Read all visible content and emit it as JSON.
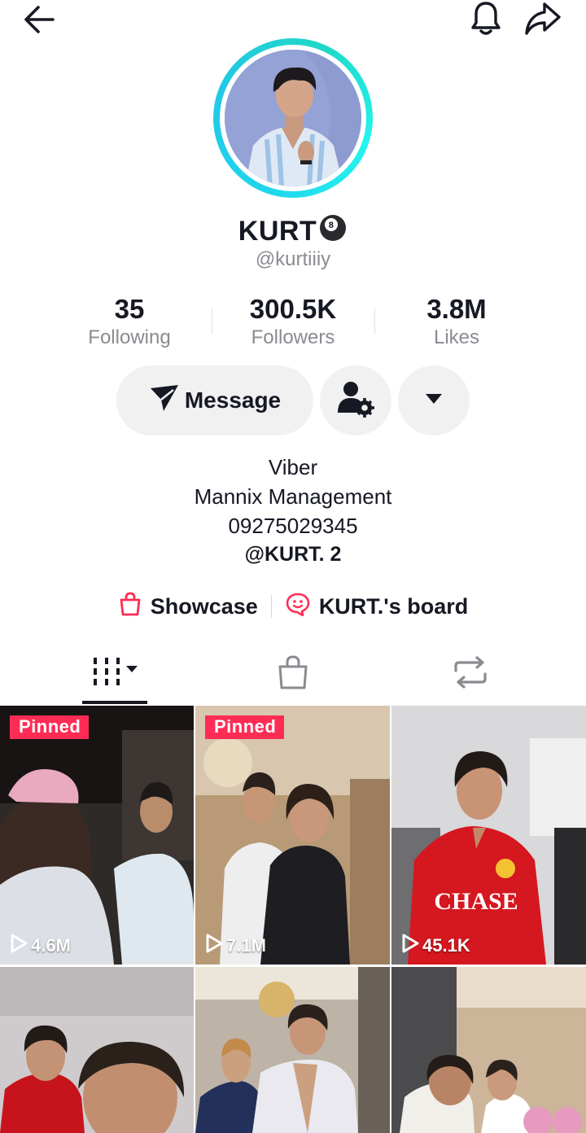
{
  "profile": {
    "display_name": "KURT",
    "username": "@kurtiiiy"
  },
  "stats": {
    "following_count": "35",
    "following_label": "Following",
    "followers_count": "300.5K",
    "followers_label": "Followers",
    "likes_count": "3.8M",
    "likes_label": "Likes"
  },
  "actions": {
    "message_label": "Message"
  },
  "bio": {
    "line1": "Viber",
    "line2": "Mannix Management",
    "line3": "09275029345",
    "line4": "@KURT. 2"
  },
  "links": {
    "showcase_label": "Showcase",
    "board_label": "KURT.'s board"
  },
  "icons": {
    "top_left": "back-arrow-icon",
    "top_right": [
      "bell-icon",
      "share-icon"
    ],
    "tabs": [
      "videos-grid-icon",
      "shop-bag-icon",
      "repost-icon"
    ]
  },
  "videos": [
    {
      "pinned": "Pinned",
      "views": "4.6M"
    },
    {
      "pinned": "Pinned",
      "views": "7.1M"
    },
    {
      "views": "45.1K"
    },
    {},
    {},
    {}
  ],
  "colors": {
    "accent_red": "#fe2c55",
    "avatar_ring": "#20d5ec",
    "text_primary": "#161823",
    "text_secondary": "#8a8b91",
    "button_bg": "#f1f1f2"
  }
}
